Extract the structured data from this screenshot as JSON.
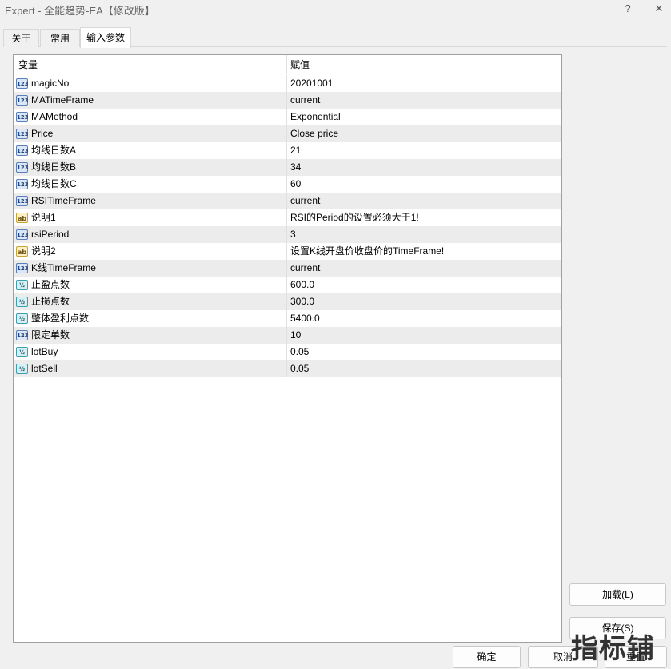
{
  "window": {
    "title": "Expert - 全能趋势-EA【修改版】",
    "help_label": "?",
    "close_label": "✕"
  },
  "tabs": [
    {
      "label": "关于",
      "active": false
    },
    {
      "label": "常用",
      "active": false
    },
    {
      "label": "输入参数",
      "active": true
    }
  ],
  "table": {
    "headers": {
      "name": "变量",
      "value": "赋值"
    },
    "rows": [
      {
        "icon": "int",
        "icon_text": "123",
        "name": "magicNo",
        "value": "20201001"
      },
      {
        "icon": "int",
        "icon_text": "123",
        "name": "MATimeFrame",
        "value": "current"
      },
      {
        "icon": "int",
        "icon_text": "123",
        "name": "MAMethod",
        "value": "Exponential"
      },
      {
        "icon": "int",
        "icon_text": "123",
        "name": "Price",
        "value": "Close price"
      },
      {
        "icon": "int",
        "icon_text": "123",
        "name": "均线日数A",
        "value": "21"
      },
      {
        "icon": "int",
        "icon_text": "123",
        "name": "均线日数B",
        "value": "34"
      },
      {
        "icon": "int",
        "icon_text": "123",
        "name": "均线日数C",
        "value": "60"
      },
      {
        "icon": "int",
        "icon_text": "123",
        "name": "RSITimeFrame",
        "value": "current"
      },
      {
        "icon": "str",
        "icon_text": "ab",
        "name": "说明1",
        "value": "RSI的Period的设置必须大于1!"
      },
      {
        "icon": "int",
        "icon_text": "123",
        "name": "rsiPeriod",
        "value": "3"
      },
      {
        "icon": "str",
        "icon_text": "ab",
        "name": "说明2",
        "value": "设置K线开盘价收盘价的TimeFrame!"
      },
      {
        "icon": "int",
        "icon_text": "123",
        "name": "K线TimeFrame",
        "value": "current"
      },
      {
        "icon": "dbl",
        "icon_text": "½",
        "name": "止盈点数",
        "value": "600.0"
      },
      {
        "icon": "dbl",
        "icon_text": "½",
        "name": "止损点数",
        "value": "300.0"
      },
      {
        "icon": "dbl",
        "icon_text": "½",
        "name": "整体盈利点数",
        "value": "5400.0"
      },
      {
        "icon": "int",
        "icon_text": "123",
        "name": "限定单数",
        "value": "10"
      },
      {
        "icon": "dbl",
        "icon_text": "½",
        "name": "lotBuy",
        "value": "0.05"
      },
      {
        "icon": "dbl",
        "icon_text": "½",
        "name": "lotSell",
        "value": "0.05"
      }
    ]
  },
  "buttons": {
    "load": "加载(L)",
    "save": "保存(S)",
    "ok": "确定",
    "cancel": "取消",
    "reset": "重置"
  },
  "watermark": "指标铺"
}
